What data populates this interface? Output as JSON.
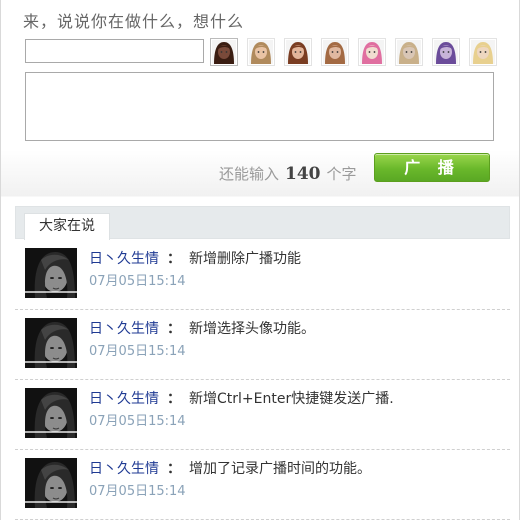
{
  "compose": {
    "prompt": "来，说说你在做什么，想什么",
    "name_value": "",
    "message_value": "",
    "counter_prefix": "还能输入",
    "counter_value": "140",
    "counter_suffix": "个字",
    "submit_label": "广 播"
  },
  "avatar_choices": [
    {
      "name": "avatar-option-1",
      "tone": "#7a4a3a",
      "hair": "#3a1d12"
    },
    {
      "name": "avatar-option-2",
      "tone": "#e9c3a4",
      "hair": "#b08a5c"
    },
    {
      "name": "avatar-option-3",
      "tone": "#e3b59a",
      "hair": "#7a3d22"
    },
    {
      "name": "avatar-option-4",
      "tone": "#e0b8a0",
      "hair": "#a36a43"
    },
    {
      "name": "avatar-option-5",
      "tone": "#f1ddd0",
      "hair": "#e06fa0"
    },
    {
      "name": "avatar-option-6",
      "tone": "#d9c6b6",
      "hair": "#c9b08a"
    },
    {
      "name": "avatar-option-7",
      "tone": "#c7b3d8",
      "hair": "#6b4c9a"
    },
    {
      "name": "avatar-option-8",
      "tone": "#eed7c0",
      "hair": "#e8d08f"
    }
  ],
  "feed": {
    "tab_label": "大家在说",
    "separator": "：",
    "items": [
      {
        "user": "日丶久生情",
        "text": "新增删除广播功能",
        "time": "07月05日15:14"
      },
      {
        "user": "日丶久生情",
        "text": "新增选择头像功能。",
        "time": "07月05日15:14"
      },
      {
        "user": "日丶久生情",
        "text": "新增Ctrl+Enter快捷键发送广播.",
        "time": "07月05日15:14"
      },
      {
        "user": "日丶久生情",
        "text": "增加了记录广播时间的功能。",
        "time": "07月05日15:14"
      }
    ]
  }
}
